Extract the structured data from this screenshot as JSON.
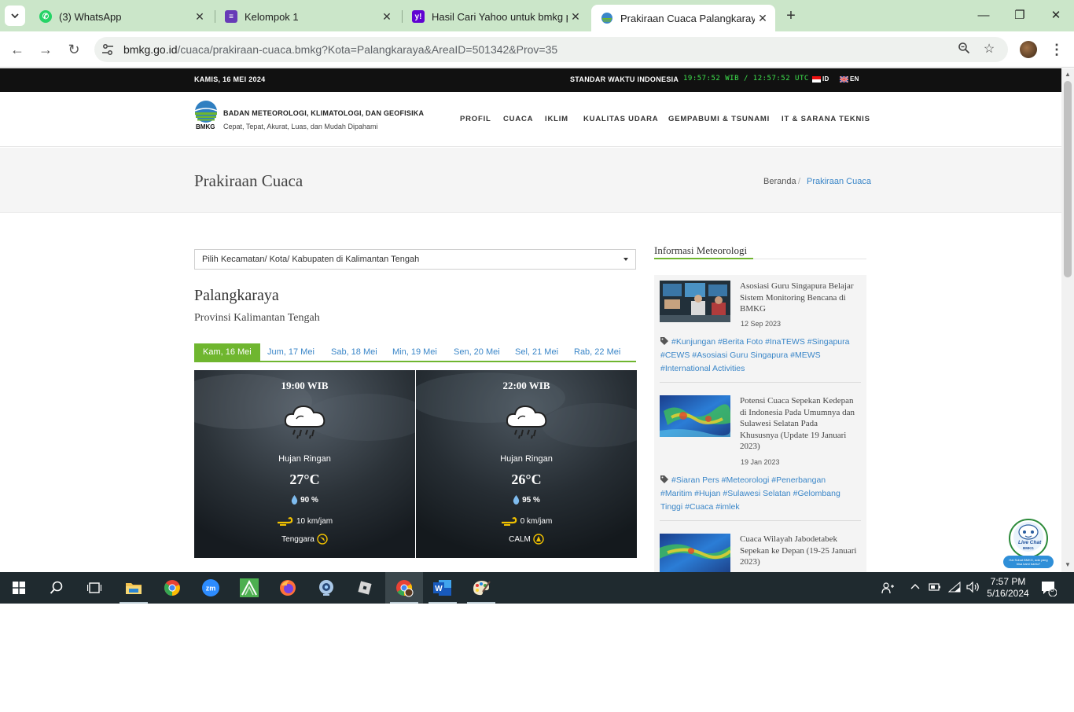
{
  "browser": {
    "tabs": [
      {
        "title": "(3) WhatsApp",
        "icon": "whatsapp-icon"
      },
      {
        "title": "Kelompok 1",
        "icon": "forms-icon"
      },
      {
        "title": "Hasil Cari Yahoo untuk bmkg pa",
        "icon": "yahoo-icon"
      },
      {
        "title": "Prakiraan Cuaca Palangkaraya -",
        "icon": "bmkg-icon",
        "active": true
      }
    ],
    "url_host": "bmkg.go.id",
    "url_path": "/cuaca/prakiraan-cuaca.bmkg?Kota=Palangkaraya&AreaID=501342&Prov=35"
  },
  "topbar": {
    "date": "KAMIS, 16 MEI 2024",
    "standard_time_label": "STANDAR WAKTU INDONESIA",
    "clock": "19:57:52 WIB / 12:57:52 UTC",
    "lang_id": "ID",
    "lang_en": "EN"
  },
  "header": {
    "logo_text": "BMKG",
    "org_name": "BADAN METEOROLOGI, KLIMATOLOGI, DAN GEOFISIKA",
    "tagline": "Cepat, Tepat, Akurat, Luas, dan Mudah Dipahami",
    "menu": [
      "PROFIL",
      "CUACA",
      "IKLIM",
      "KUALITAS UDARA",
      "GEMPABUMI & TSUNAMI",
      "IT & SARANA TEKNIS"
    ]
  },
  "page": {
    "title": "Prakiraan Cuaca",
    "breadcrumb": [
      "Beranda",
      "/",
      "Prakiraan Cuaca"
    ]
  },
  "forecast": {
    "select_placeholder": "Pilih Kecamatan/ Kota/ Kabupaten di Kalimantan Tengah",
    "city": "Palangkaraya",
    "province": "Provinsi Kalimantan Tengah",
    "days": [
      "Kam, 16 Mei",
      "Jum, 17 Mei",
      "Sab, 18 Mei",
      "Min, 19 Mei",
      "Sen, 20 Mei",
      "Sel, 21 Mei",
      "Rab, 22 Mei"
    ],
    "cards": [
      {
        "time": "19:00 WIB",
        "condition": "Hujan Ringan",
        "temp": "27°C",
        "humidity": "90 %",
        "wind": "10 km/jam",
        "direction": "Tenggara"
      },
      {
        "time": "22:00 WIB",
        "condition": "Hujan Ringan",
        "temp": "26°C",
        "humidity": "95 %",
        "wind": "0 km/jam",
        "direction": "CALM"
      }
    ]
  },
  "sidebar": {
    "title": "Informasi Meteorologi",
    "news": [
      {
        "title": "Asosiasi Guru Singapura Belajar Sistem Monitoring Bencana di BMKG",
        "date": "12 Sep 2023",
        "tags": "#Kunjungan #Berita Foto #InaTEWS #Singapura #CEWS #Asosiasi Guru Singapura #MEWS #International Activities"
      },
      {
        "title": "Potensi Cuaca Sepekan Kedepan di Indonesia Pada Umumnya dan Sulawesi Selatan Pada Khususnya (Update 19 Januari 2023)",
        "date": "19 Jan 2023",
        "tags": "#Siaran Pers #Meteorologi #Penerbangan #Maritim #Hujan #Sulawesi Selatan #Gelombang Tinggi #Cuaca #imlek"
      },
      {
        "title": "Cuaca Wilayah Jabodetabek Sepekan ke Depan (19-25 Januari 2023)"
      }
    ]
  },
  "livechat": {
    "label": "Live Chat",
    "sub": "BMKG",
    "hint": "Hai Sobat BMKG, ada yang bisa kami bantu?"
  },
  "taskbar": {
    "time": "7:57 PM",
    "date": "5/16/2024",
    "notifications": "8"
  }
}
